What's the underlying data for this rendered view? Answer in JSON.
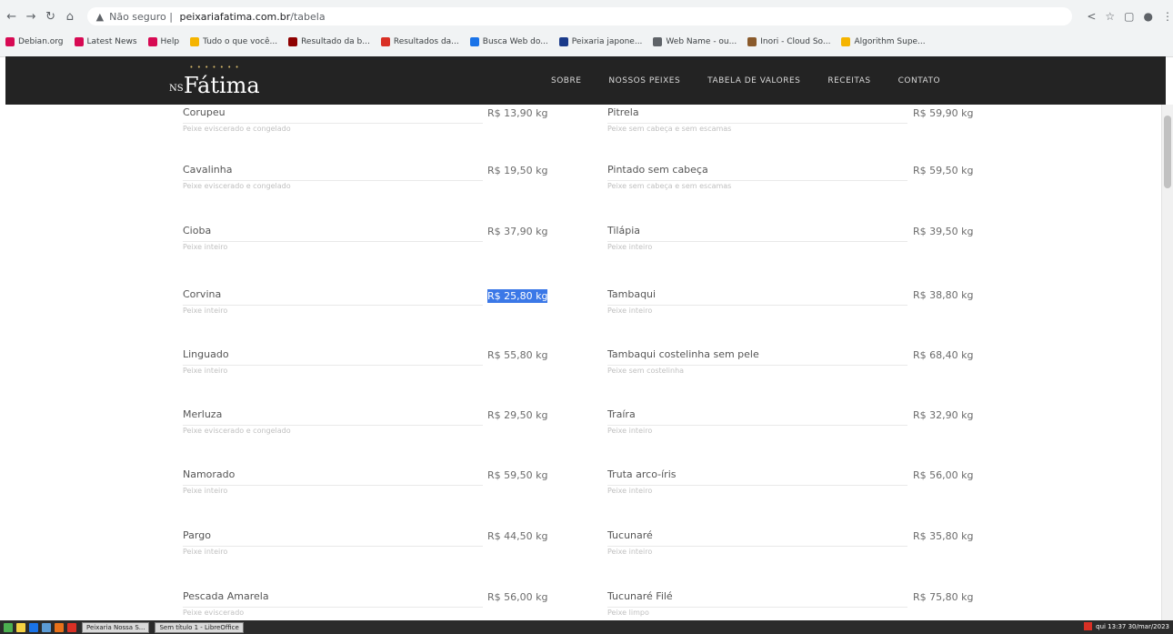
{
  "browser": {
    "security_label": "Não seguro",
    "domain": "peixariafatima.com.br",
    "path": "/tabela",
    "bookmarks": [
      {
        "label": "Debian.org",
        "color": "#d70a53"
      },
      {
        "label": "Latest News",
        "color": "#d70a53"
      },
      {
        "label": "Help",
        "color": "#d70a53"
      },
      {
        "label": "Tudo o que você...",
        "color": "#f5b400"
      },
      {
        "label": "Resultado da b...",
        "color": "#8e0000"
      },
      {
        "label": "Resultados da...",
        "color": "#d93025"
      },
      {
        "label": "Busca Web do...",
        "color": "#1a73e8"
      },
      {
        "label": "Peixaria japone...",
        "color": "#1a3a8a"
      },
      {
        "label": "Web Name - ou...",
        "color": "#5f6368"
      },
      {
        "label": "Inori - Cloud So...",
        "color": "#8a5a2b"
      },
      {
        "label": "Algorithm Supe...",
        "color": "#f5b400"
      }
    ]
  },
  "site": {
    "logo_ns": "NS",
    "logo_name": "Fátima",
    "nav": [
      "SOBRE",
      "NOSSOS PEIXES",
      "TABELA DE VALORES",
      "RECEITAS",
      "CONTATO"
    ]
  },
  "left_items": [
    {
      "name": "Corupeu",
      "desc": "Peixe eviscerado e congelado",
      "price": "R$ 13,90 kg"
    },
    {
      "name": "Cavalinha",
      "desc": "Peixe eviscerado e congelado",
      "price": "R$ 19,50 kg"
    },
    {
      "name": "Cioba",
      "desc": "Peixe inteiro",
      "price": "R$ 37,90 kg"
    },
    {
      "name": "Corvina",
      "desc": "Peixe inteiro",
      "price": "R$ 25,80 kg"
    },
    {
      "name": "Linguado",
      "desc": "Peixe inteiro",
      "price": "R$ 55,80 kg"
    },
    {
      "name": "Merluza",
      "desc": "Peixe eviscerado e congelado",
      "price": "R$ 29,50 kg"
    },
    {
      "name": "Namorado",
      "desc": "Peixe inteiro",
      "price": "R$ 59,50 kg"
    },
    {
      "name": "Pargo",
      "desc": "Peixe inteiro",
      "price": "R$ 44,50 kg"
    },
    {
      "name": "Pescada Amarela",
      "desc": "Peixe eviscerado",
      "price": "R$ 56,00 kg"
    }
  ],
  "right_items": [
    {
      "name": "Pitrela",
      "desc": "Peixe sem cabeça e sem escamas",
      "price": "R$ 59,90 kg"
    },
    {
      "name": "Pintado sem cabeça",
      "desc": "Peixe sem cabeça e sem escamas",
      "price": "R$ 59,50 kg"
    },
    {
      "name": "Tilápia",
      "desc": "Peixe inteiro",
      "price": "R$ 39,50 kg"
    },
    {
      "name": "Tambaqui",
      "desc": "Peixe inteiro",
      "price": "R$ 38,80 kg"
    },
    {
      "name": "Tambaqui costelinha sem pele",
      "desc": "Peixe sem costelinha",
      "price": "R$ 68,40 kg"
    },
    {
      "name": "Traíra",
      "desc": "Peixe inteiro",
      "price": "R$ 32,90 kg"
    },
    {
      "name": "Truta arco-íris",
      "desc": "Peixe inteiro",
      "price": "R$ 56,00 kg"
    },
    {
      "name": "Tucunaré",
      "desc": "Peixe inteiro",
      "price": "R$ 35,80 kg"
    },
    {
      "name": "Tucunaré Filé",
      "desc": "Peixe limpo",
      "price": "R$ 75,80 kg"
    }
  ],
  "taskbar": {
    "windows": [
      "Peixaria Nossa S...",
      "Sem título 1 - LibreOffice"
    ],
    "clock": "qui 13:37 30/mar/2023"
  }
}
